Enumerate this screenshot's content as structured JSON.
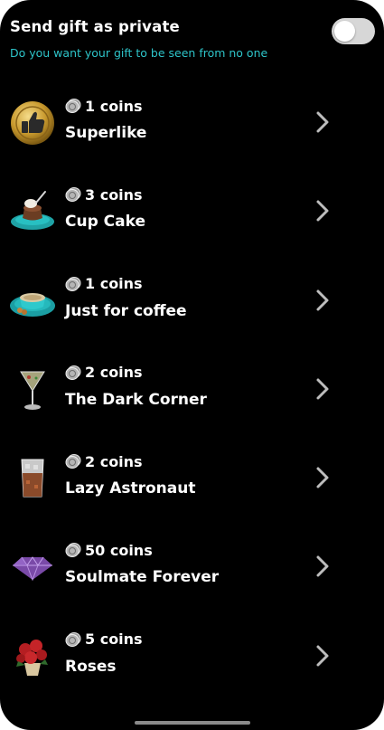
{
  "header": {
    "title": "Send gift as private",
    "subtitle": "Do you want your gift to be seen from no one",
    "toggle_on": false
  },
  "gifts": [
    {
      "icon": "thumbs-up-icon",
      "price": "1 coins",
      "name": "Superlike"
    },
    {
      "icon": "cupcake-icon",
      "price": "3 coins",
      "name": "Cup Cake"
    },
    {
      "icon": "coffee-cup-icon",
      "price": "1 coins",
      "name": "Just for coffee"
    },
    {
      "icon": "martini-glass-icon",
      "price": "2 coins",
      "name": "The Dark Corner"
    },
    {
      "icon": "whiskey-glass-icon",
      "price": "2 coins",
      "name": "Lazy Astronaut"
    },
    {
      "icon": "diamond-icon",
      "price": "50 coins",
      "name": "Soulmate Forever"
    },
    {
      "icon": "roses-bouquet-icon",
      "price": "5 coins",
      "name": "Roses"
    }
  ],
  "colors": {
    "background": "#000000",
    "subtitle": "#2ec4c9",
    "toggle_track": "#d7d7d7",
    "chevron": "#bdbdbd"
  }
}
